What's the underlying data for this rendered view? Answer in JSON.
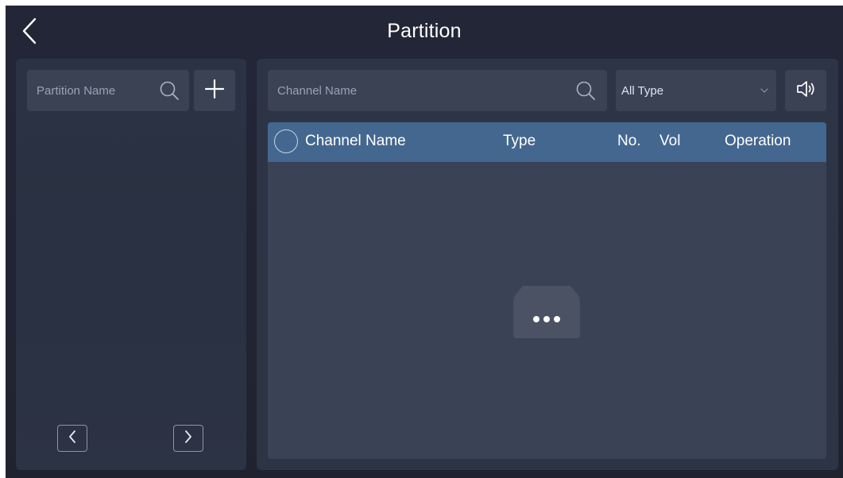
{
  "header": {
    "title": "Partition",
    "back_icon": "chevron-left-icon"
  },
  "left_panel": {
    "search": {
      "placeholder": "Partition Name",
      "icon": "search-icon"
    },
    "add_icon": "plus-icon",
    "pager": {
      "prev_icon": "chevron-left-icon",
      "next_icon": "chevron-right-icon"
    }
  },
  "right_panel": {
    "search": {
      "placeholder": "Channel Name",
      "icon": "search-icon"
    },
    "type_filter": {
      "selected": "All Type",
      "icon": "chevron-down-icon"
    },
    "speaker_icon": "speaker-icon",
    "table": {
      "columns": [
        "Channel Name",
        "Type",
        "No.",
        "Vol",
        "Operation"
      ],
      "rows": [],
      "empty_icon": "empty-box-icon"
    }
  },
  "colors": {
    "background": "#222535",
    "panel": "#2d3446",
    "field": "#3a4254",
    "table_header": "#44678f"
  }
}
